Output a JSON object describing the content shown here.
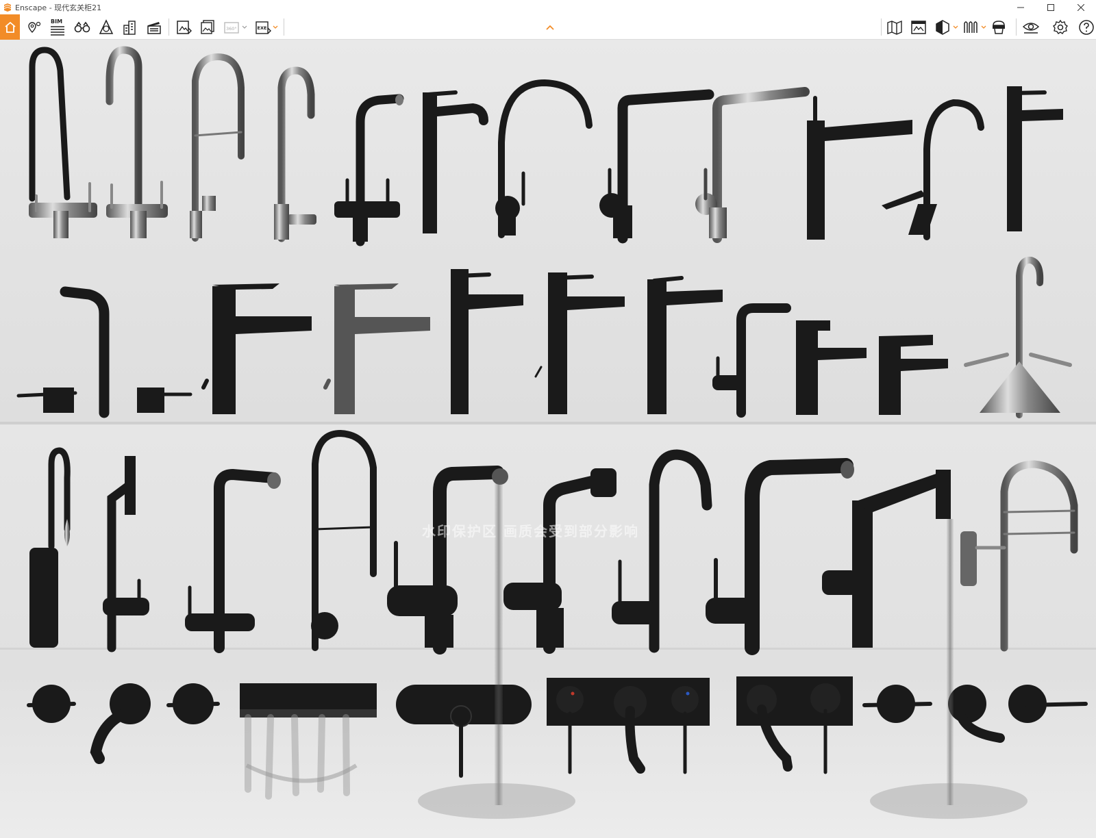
{
  "window": {
    "title": "Enscape - 现代玄关柜21",
    "controls": [
      "minimize-icon",
      "maximize-icon",
      "close-icon"
    ]
  },
  "toolbar": {
    "accent_color": "#f28c28",
    "left_icons": [
      "home-icon",
      "locations-icon",
      "bim-icon",
      "binoculars-icon",
      "atmosphere-icon",
      "buildings-icon",
      "video-editor-icon",
      "screenshot-icon",
      "batch-render-icon",
      "panorama-360-icon",
      "export-exe-icon"
    ],
    "bim_label": "BIM",
    "panorama_label": "360°",
    "exe_label": "EXE",
    "right_icons": [
      "map-icon",
      "views-icon",
      "section-icon",
      "material-icon",
      "asset-library-icon",
      "visual-settings-icon",
      "settings-icon",
      "help-icon"
    ]
  },
  "viewport": {
    "watermark_text": "水印保护区  画质会受到部分影响",
    "scene": "faucet-collection-render"
  }
}
